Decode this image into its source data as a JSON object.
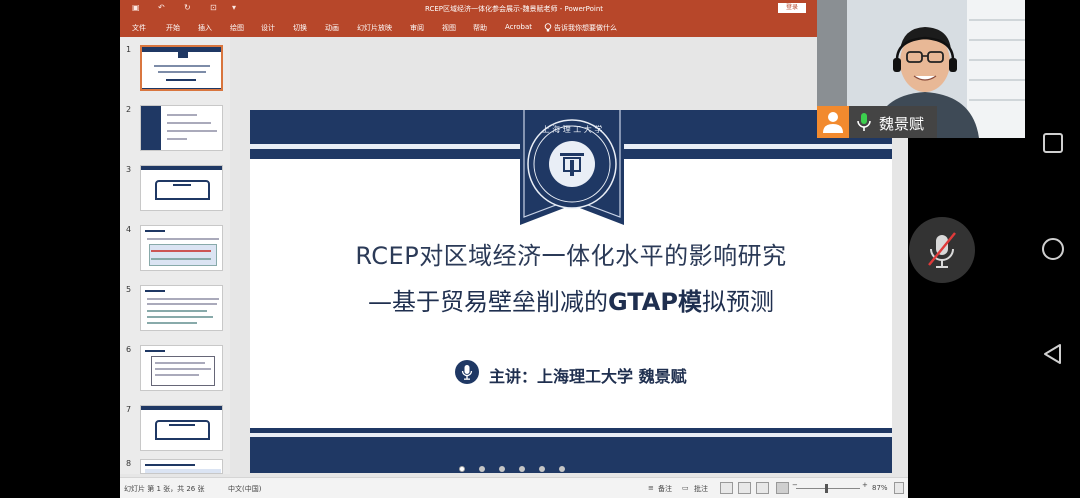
{
  "window": {
    "title": "RCEP区域经济一体化参会展示-魏景赋老师  -  PowerPoint",
    "login_label": "登录"
  },
  "ribbon": {
    "tabs": [
      "文件",
      "开始",
      "插入",
      "绘图",
      "设计",
      "切换",
      "动画",
      "幻灯片放映",
      "审阅",
      "视图",
      "帮助",
      "Acrobat"
    ],
    "tell_me": "告诉我你想要做什么"
  },
  "thumbnails": {
    "numbers": [
      "1",
      "2",
      "3",
      "4",
      "5",
      "6",
      "7",
      "8"
    ],
    "selected": "1"
  },
  "slide": {
    "title_line1": "RCEP对区域经济一体化水平的影响研究",
    "title_line2_prefix": "—基于贸易壁垒削减的",
    "title_line2_bold1": "GTAP模",
    "title_line2_suffix": "拟预测",
    "speaker": "主讲：上海理工大学 魏景赋",
    "seal_alt": "上海理工大学 校徽"
  },
  "status": {
    "slide_count": "幻灯片 第 1 张，共 26 张",
    "language": "中文(中国)",
    "notes_label": "备注",
    "comments_label": "批注",
    "zoom": "87%"
  },
  "video": {
    "participant_name": "魏景赋"
  },
  "colors": {
    "ppt_accent": "#b7472a",
    "slide_navy": "#1f3864",
    "avatar_orange": "#f28a2e"
  },
  "icons": [
    "undo-icon",
    "redo-icon",
    "save-icon",
    "lightbulb-icon",
    "mic-icon",
    "mic-muted-icon",
    "square-icon",
    "circle-icon",
    "back-triangle-icon",
    "person-icon"
  ]
}
